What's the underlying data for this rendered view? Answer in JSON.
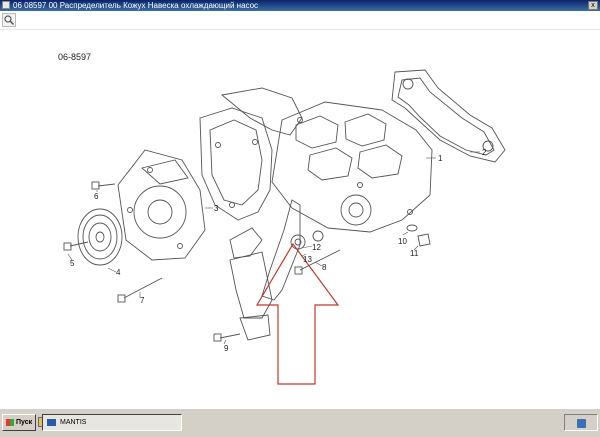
{
  "window": {
    "title": "06 08597 00 Распределитель Кожух Навеска охлаждающий насос",
    "close_label": "x"
  },
  "toolbar": {
    "zoom_icon": "magnifier-icon"
  },
  "diagram": {
    "drawing_number": "06-8597",
    "callouts": [
      {
        "id": "1",
        "label": "1"
      },
      {
        "id": "2",
        "label": "2"
      },
      {
        "id": "3",
        "label": "3"
      },
      {
        "id": "4",
        "label": "4"
      },
      {
        "id": "5",
        "label": "5"
      },
      {
        "id": "6",
        "label": "6"
      },
      {
        "id": "7",
        "label": "7"
      },
      {
        "id": "8",
        "label": "8"
      },
      {
        "id": "9",
        "label": "9"
      },
      {
        "id": "10",
        "label": "10"
      },
      {
        "id": "11",
        "label": "11"
      },
      {
        "id": "12",
        "label": "12"
      },
      {
        "id": "13",
        "label": "13"
      }
    ],
    "arrow_color": "#c0392b"
  },
  "taskbar": {
    "start_label": "Пуск",
    "active_task": "MANTIS"
  }
}
